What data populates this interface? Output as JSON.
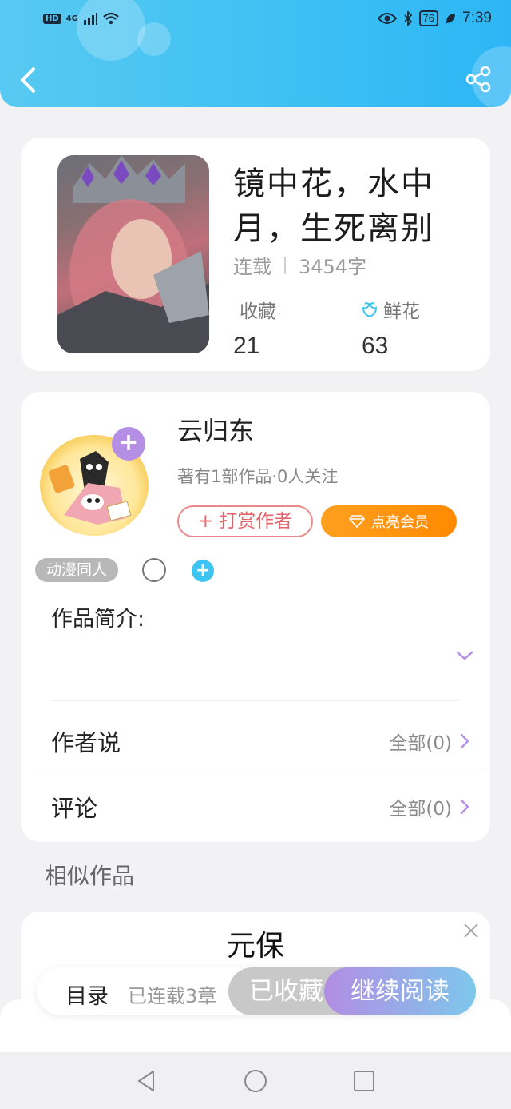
{
  "status": {
    "left_badges": [
      "HD",
      "4G"
    ],
    "battery": "76",
    "time": "7:39"
  },
  "book": {
    "title": "镜中花，水中月，生死离别",
    "status": "连载",
    "word_count": "3454字",
    "collect_label": "收藏",
    "collect_value": "21",
    "flower_label": "鲜花",
    "flower_value": "63"
  },
  "author": {
    "name": "云归东",
    "info": "著有1部作品·0人关注",
    "reward_label": "打赏作者",
    "vip_label": "点亮会员",
    "tag": "动漫同人"
  },
  "sections": {
    "intro_label": "作品简介:",
    "author_says_label": "作者说",
    "author_says_value": "全部(0)",
    "comments_label": "评论",
    "comments_value": "全部(0)"
  },
  "similar": {
    "title": "相似作品",
    "first_title": "元保"
  },
  "action_bar": {
    "toc_label": "目录",
    "chapters_label": "已连载3章",
    "favorited_label": "已收藏",
    "continue_label": "继续阅读"
  },
  "colors": {
    "header": "#3cc0f3",
    "accent_purple": "#b58ee6",
    "reward_red": "#e5646b",
    "vip_orange": "#ff9010"
  }
}
